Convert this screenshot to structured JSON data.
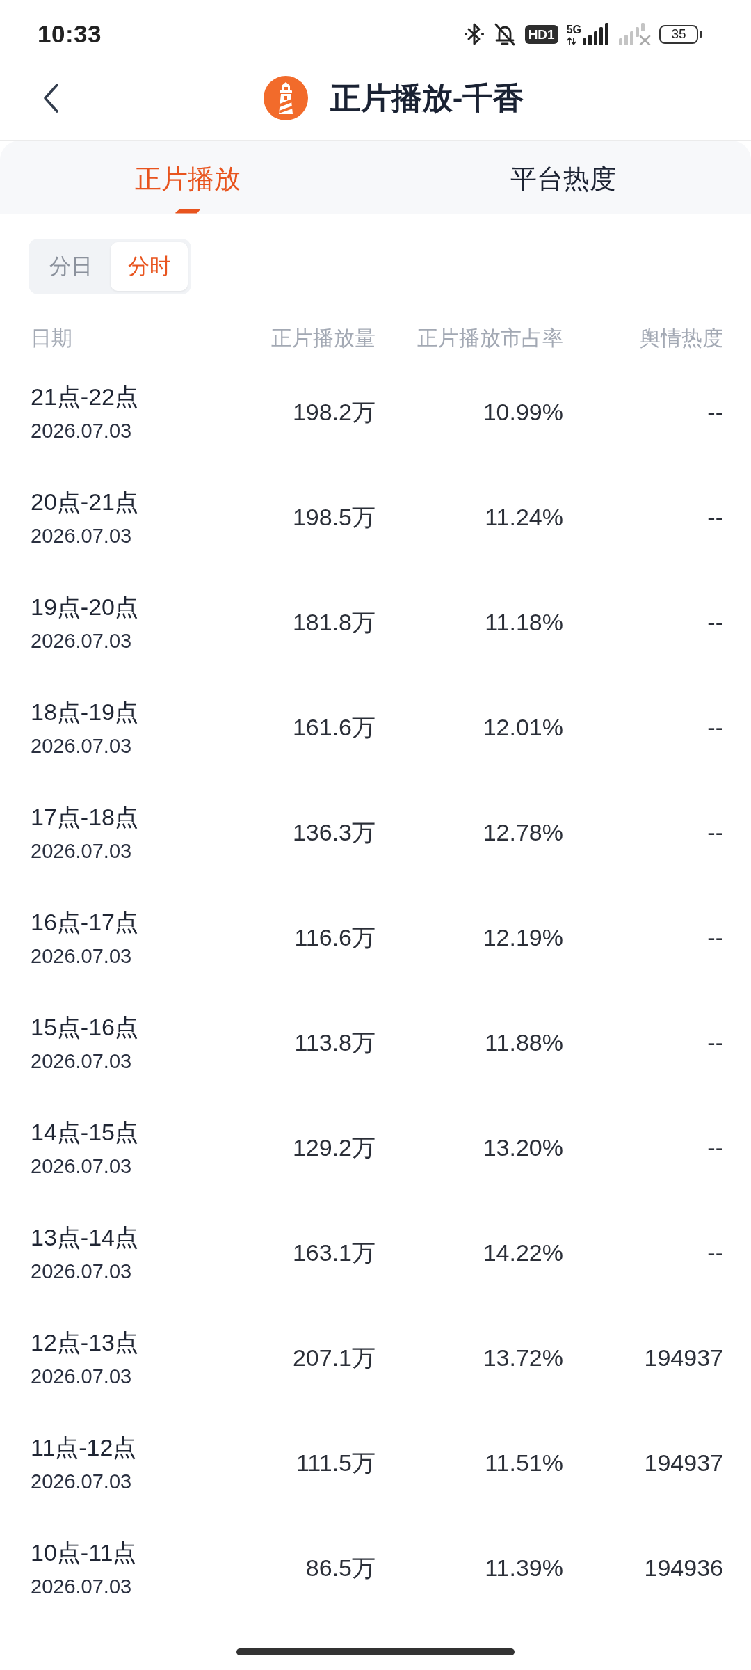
{
  "status_bar": {
    "time": "10:33",
    "hd_badge": "HD1",
    "network": "5G",
    "battery": "35"
  },
  "header": {
    "title": "正片播放-千香"
  },
  "tabs": [
    {
      "label": "正片播放",
      "selected": true
    },
    {
      "label": "平台热度",
      "selected": false
    }
  ],
  "granularity": [
    {
      "label": "分日",
      "selected": false
    },
    {
      "label": "分时",
      "selected": true
    }
  ],
  "table": {
    "columns": [
      "日期",
      "正片播放量",
      "正片播放市占率",
      "舆情热度"
    ],
    "rows": [
      {
        "period": "21点-22点",
        "date": "2026.07.03",
        "plays": "198.2万",
        "share": "10.99%",
        "heat": "--"
      },
      {
        "period": "20点-21点",
        "date": "2026.07.03",
        "plays": "198.5万",
        "share": "11.24%",
        "heat": "--"
      },
      {
        "period": "19点-20点",
        "date": "2026.07.03",
        "plays": "181.8万",
        "share": "11.18%",
        "heat": "--"
      },
      {
        "period": "18点-19点",
        "date": "2026.07.03",
        "plays": "161.6万",
        "share": "12.01%",
        "heat": "--"
      },
      {
        "period": "17点-18点",
        "date": "2026.07.03",
        "plays": "136.3万",
        "share": "12.78%",
        "heat": "--"
      },
      {
        "period": "16点-17点",
        "date": "2026.07.03",
        "plays": "116.6万",
        "share": "12.19%",
        "heat": "--"
      },
      {
        "period": "15点-16点",
        "date": "2026.07.03",
        "plays": "113.8万",
        "share": "11.88%",
        "heat": "--"
      },
      {
        "period": "14点-15点",
        "date": "2026.07.03",
        "plays": "129.2万",
        "share": "13.20%",
        "heat": "--"
      },
      {
        "period": "13点-14点",
        "date": "2026.07.03",
        "plays": "163.1万",
        "share": "14.22%",
        "heat": "--"
      },
      {
        "period": "12点-13点",
        "date": "2026.07.03",
        "plays": "207.1万",
        "share": "13.72%",
        "heat": "194937"
      },
      {
        "period": "11点-12点",
        "date": "2026.07.03",
        "plays": "111.5万",
        "share": "11.51%",
        "heat": "194937"
      },
      {
        "period": "10点-11点",
        "date": "2026.07.03",
        "plays": "86.5万",
        "share": "11.39%",
        "heat": "194936"
      }
    ]
  }
}
